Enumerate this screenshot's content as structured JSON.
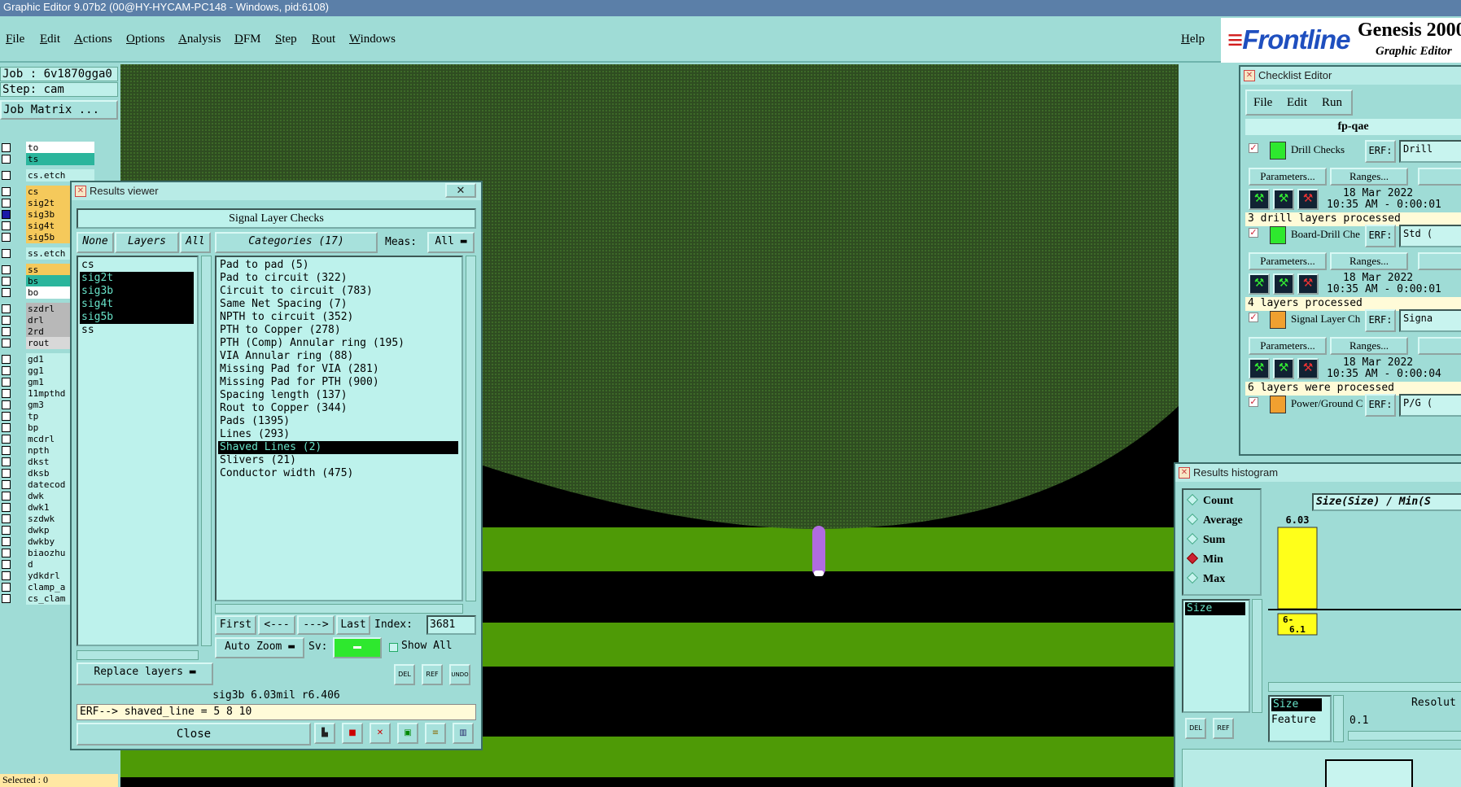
{
  "window_title": "Graphic Editor 9.07b2 (00@HY-HYCAM-PC148 - Windows, pid:6108)",
  "menubar": {
    "items": [
      "File",
      "Edit",
      "Actions",
      "Options",
      "Analysis",
      "DFM",
      "Step",
      "Rout",
      "Windows"
    ],
    "help": "Help"
  },
  "logo": {
    "brand": "Frontline",
    "product": "Genesis 2000",
    "subtitle": "Graphic Editor"
  },
  "job_panel": {
    "job": "Job : 6v1870gga0",
    "step": "Step: cam",
    "job_matrix": "Job Matrix ...",
    "layers": [
      {
        "name": "to",
        "color": "#ffffff",
        "checked": false
      },
      {
        "name": "ts",
        "color": "#2bb59c",
        "checked": false
      },
      {
        "name": "cs.etch",
        "color": "#bff0ea",
        "checked": false
      },
      {
        "name": "cs",
        "color": "#f5c95b",
        "checked": false
      },
      {
        "name": "sig2t",
        "color": "#f5c95b",
        "checked": false
      },
      {
        "name": "sig3b",
        "color": "#f5c95b",
        "checked": true
      },
      {
        "name": "sig4t",
        "color": "#f5c95b",
        "checked": false
      },
      {
        "name": "sig5b",
        "color": "#f5c95b",
        "checked": false
      },
      {
        "name": "ss.etch",
        "color": "#bff0ea",
        "checked": false
      },
      {
        "name": "ss",
        "color": "#f5c95b",
        "checked": false
      },
      {
        "name": "bs",
        "color": "#2bb59c",
        "checked": false
      },
      {
        "name": "bo",
        "color": "#ffffff",
        "checked": false
      },
      {
        "name": "szdrl",
        "color": "#b8b8b8",
        "checked": false
      },
      {
        "name": "drl",
        "color": "#b8b8b8",
        "checked": false
      },
      {
        "name": "2rd",
        "color": "#b8b8b8",
        "checked": false
      },
      {
        "name": "rout",
        "color": "#d8d8d8",
        "checked": false
      },
      {
        "name": "gd1",
        "color": "#bff0ea",
        "checked": false
      },
      {
        "name": "gg1",
        "color": "#bff0ea",
        "checked": false
      },
      {
        "name": "gm1",
        "color": "#bff0ea",
        "checked": false
      },
      {
        "name": "11mpthd",
        "color": "#bff0ea",
        "checked": false
      },
      {
        "name": "gm3",
        "color": "#bff0ea",
        "checked": false
      },
      {
        "name": "tp",
        "color": "#bff0ea",
        "checked": false
      },
      {
        "name": "bp",
        "color": "#bff0ea",
        "checked": false
      },
      {
        "name": "mcdrl",
        "color": "#bff0ea",
        "checked": false
      },
      {
        "name": "npth",
        "color": "#bff0ea",
        "checked": false
      },
      {
        "name": "dkst",
        "color": "#bff0ea",
        "checked": false
      },
      {
        "name": "dksb",
        "color": "#bff0ea",
        "checked": false
      },
      {
        "name": "datecod",
        "color": "#bff0ea",
        "checked": false
      },
      {
        "name": "dwk",
        "color": "#bff0ea",
        "checked": false
      },
      {
        "name": "dwk1",
        "color": "#bff0ea",
        "checked": false
      },
      {
        "name": "szdwk",
        "color": "#bff0ea",
        "checked": false
      },
      {
        "name": "dwkp",
        "color": "#bff0ea",
        "checked": false
      },
      {
        "name": "dwkby",
        "color": "#bff0ea",
        "checked": false
      },
      {
        "name": "biaozhu",
        "color": "#bff0ea",
        "checked": false
      },
      {
        "name": "d",
        "color": "#bff0ea",
        "checked": false
      },
      {
        "name": "ydkdrl",
        "color": "#bff0ea",
        "checked": false
      },
      {
        "name": "clamp_a",
        "color": "#bff0ea",
        "checked": false
      },
      {
        "name": "cs_clam",
        "color": "#bff0ea",
        "checked": false
      }
    ],
    "selected": "Selected : 0"
  },
  "results_viewer": {
    "title": "Results viewer",
    "header": "Signal Layer Checks",
    "none_btn": "None",
    "layers_btn": "Layers",
    "all_btn": "All",
    "categories_btn": "Categories (17)",
    "meas_label": "Meas:",
    "meas_value": "All",
    "layers": [
      {
        "name": "cs",
        "selected": false
      },
      {
        "name": "sig2t",
        "selected": true
      },
      {
        "name": "sig3b",
        "selected": true
      },
      {
        "name": "sig4t",
        "selected": true
      },
      {
        "name": "sig5b",
        "selected": true
      },
      {
        "name": "ss",
        "selected": false
      }
    ],
    "categories": [
      {
        "name": "Pad to pad (5)",
        "selected": false
      },
      {
        "name": "Pad to circuit (322)",
        "selected": false
      },
      {
        "name": "Circuit to circuit (783)",
        "selected": false
      },
      {
        "name": "Same Net Spacing (7)",
        "selected": false
      },
      {
        "name": "NPTH to circuit (352)",
        "selected": false
      },
      {
        "name": "PTH to Copper (278)",
        "selected": false
      },
      {
        "name": "PTH (Comp) Annular ring (195)",
        "selected": false
      },
      {
        "name": "VIA Annular ring (88)",
        "selected": false
      },
      {
        "name": "Missing Pad for VIA (281)",
        "selected": false
      },
      {
        "name": "Missing Pad for PTH (900)",
        "selected": false
      },
      {
        "name": "Spacing length (137)",
        "selected": false
      },
      {
        "name": "Rout to Copper (344)",
        "selected": false
      },
      {
        "name": "Pads (1395)",
        "selected": false
      },
      {
        "name": "Lines (293)",
        "selected": false
      },
      {
        "name": "Shaved Lines (2)",
        "selected": true
      },
      {
        "name": "Slivers (21)",
        "selected": false
      },
      {
        "name": "Conductor width (475)",
        "selected": false
      }
    ],
    "nav": {
      "first": "First",
      "prev": "<---",
      "next": "--->",
      "last": "Last",
      "index_label": "Index:",
      "index_value": "3681"
    },
    "auto_zoom": "Auto Zoom",
    "sv_label": "Sv:",
    "sv_color": "#2ee82e",
    "show_all": "Show All",
    "replace_layers": "Replace layers",
    "icon_del": "DEL",
    "icon_ref": "REF",
    "icon_undo": "UNDO",
    "status": "sig3b 6.03mil r6.406",
    "erf_line": "ERF--> shaved_line = 5 8 10",
    "close": "Close"
  },
  "checklist_editor": {
    "title": "Checklist Editor",
    "menu": [
      "File",
      "Edit",
      "Run"
    ],
    "checklist_name": "fp-qae",
    "checks": [
      {
        "name": "Drill Checks",
        "erf_label": "ERF:",
        "erf_value": "Drill",
        "date": "18 Mar 2022",
        "time": "10:35 AM - 0:00:01",
        "status": "3 drill layers processed",
        "icon_color": "#2ee82e"
      },
      {
        "name": "Board-Drill Che",
        "erf_label": "ERF:",
        "erf_value": "Std (",
        "date": "18 Mar 2022",
        "time": "10:35 AM - 0:00:01",
        "status": "4 layers processed",
        "icon_color": "#2ee82e"
      },
      {
        "name": "Signal Layer Ch",
        "erf_label": "ERF:",
        "erf_value": "Signa",
        "date": "18 Mar 2022",
        "time": "10:35 AM - 0:00:04",
        "status": "6 layers were processed",
        "icon_color": "#f0a030"
      },
      {
        "name": "Power/Ground C",
        "erf_label": "ERF:",
        "erf_value": "P/G (",
        "date": "",
        "time": "",
        "status": "",
        "icon_color": "#f0a030"
      }
    ],
    "parameters_btn": "Parameters...",
    "ranges_btn": "Ranges..."
  },
  "results_histogram": {
    "title": "Results histogram",
    "options": [
      {
        "label": "Count",
        "selected": false
      },
      {
        "label": "Average",
        "selected": false
      },
      {
        "label": "Sum",
        "selected": false
      },
      {
        "label": "Min",
        "selected": true
      },
      {
        "label": "Max",
        "selected": false
      }
    ],
    "list_items": [
      "Size"
    ],
    "chart_title": "Size(Size) / Min(S",
    "bar_value_label": "6.03",
    "bar_value": 6.03,
    "bar_category": "6-\n6.1",
    "bar_color": "#ffff1a",
    "measure_items": [
      "Size",
      "Feature"
    ],
    "resolution_label": "Resolut",
    "resolution_value": "0.1",
    "icon_del": "DEL",
    "icon_ref": "REF"
  }
}
